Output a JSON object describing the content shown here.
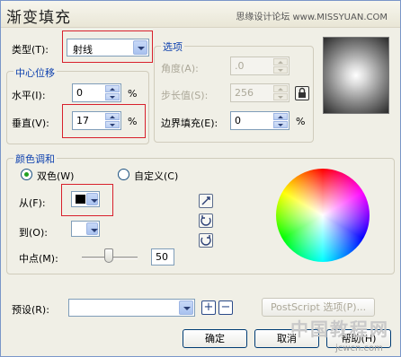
{
  "window": {
    "title": "渐变填充",
    "watermark": "思缘设计论坛 www.MISSYUAN.COM"
  },
  "type": {
    "label": "类型(T):",
    "value": "射线"
  },
  "center_offset": {
    "group_title": "中心位移",
    "horizontal": {
      "label": "水平(I):",
      "value": "0",
      "unit": "%"
    },
    "vertical": {
      "label": "垂直(V):",
      "value": "17",
      "unit": "%"
    }
  },
  "options": {
    "group_title": "选项",
    "angle": {
      "label": "角度(A):",
      "value": ".0"
    },
    "steps": {
      "label": "步长值(S):",
      "value": "256"
    },
    "edge_pad": {
      "label": "边界填充(E):",
      "value": "0",
      "unit": "%"
    }
  },
  "color_blend": {
    "group_title": "颜色调和",
    "two_color": "双色(W)",
    "custom": "自定义(C)",
    "selected": "two_color",
    "from_label": "从(F):",
    "from_color": "#000000",
    "to_label": "到(O):",
    "to_color": "#ffffff",
    "midpoint_label": "中点(M):",
    "midpoint_value": "50"
  },
  "preset": {
    "label": "预设(R):",
    "value": ""
  },
  "buttons": {
    "postscript": "PostScript 选项(P)...",
    "ok": "确定",
    "cancel": "取消",
    "help": "帮助(H)"
  },
  "corner_watermark": "中国教程网",
  "corner_url": "jcwcn.com",
  "colors": {
    "accent_red": "#d8202c",
    "group_title": "#0b3fae",
    "dialog_bg": "#f0efe6"
  }
}
